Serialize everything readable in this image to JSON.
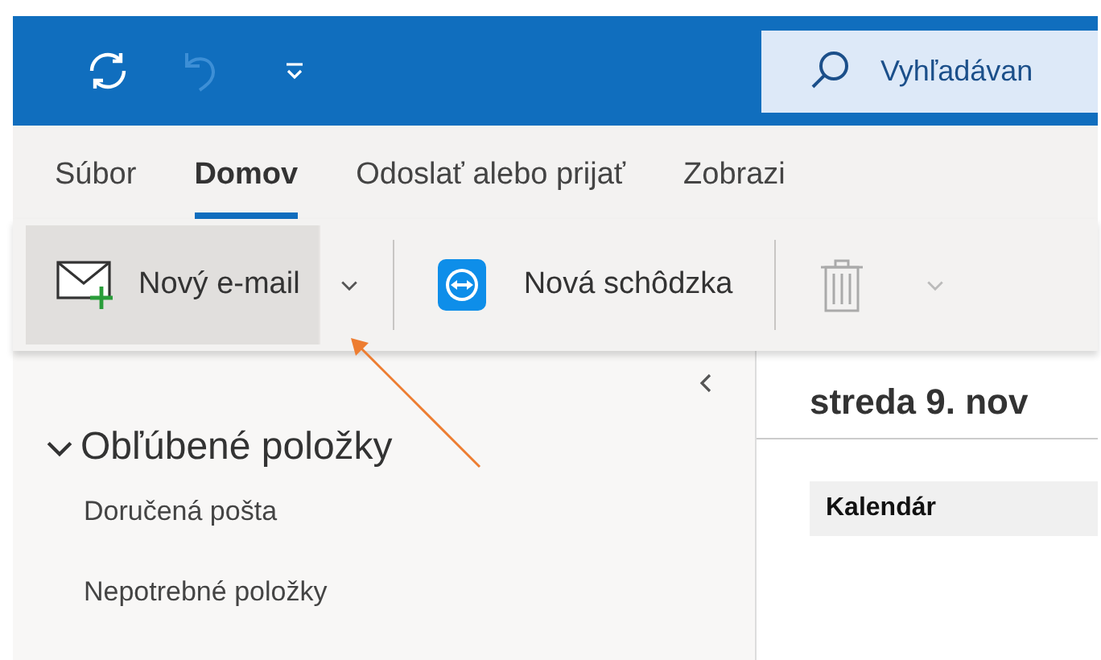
{
  "title_bar": {
    "quick_access": [
      {
        "kind": "sync",
        "disabled": false
      },
      {
        "kind": "undo",
        "disabled": true
      },
      {
        "kind": "customize",
        "disabled": false
      }
    ],
    "search": {
      "placeholder": "Vyhľadávan"
    }
  },
  "tabs": [
    {
      "label": "Súbor",
      "selected": false
    },
    {
      "label": "Domov",
      "selected": true
    },
    {
      "label": "Odoslať alebo prijať",
      "selected": false
    },
    {
      "label": "Zobrazi",
      "selected": false
    }
  ],
  "ribbon": [
    {
      "kind": "new-email",
      "label": "Nový e-mail",
      "highlighted": true
    },
    {
      "kind": "meeting",
      "label": "Nová schôdzka",
      "highlighted": false
    },
    {
      "kind": "delete",
      "highlighted": false
    }
  ],
  "sidebar": {
    "favorites": {
      "label": "Obľúbené položky",
      "expanded": true,
      "items": [
        {
          "label": "Doručená pošta"
        },
        {
          "label": "Nepotrebné položky"
        }
      ]
    }
  },
  "calendar": {
    "date": "streda 9. nov",
    "column": "Kalendár"
  }
}
